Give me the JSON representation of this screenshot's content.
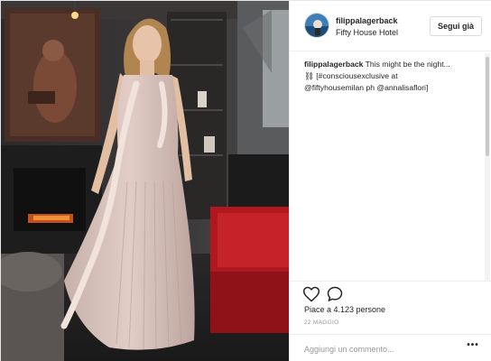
{
  "post": {
    "username": "filippalagerback",
    "location": "Fifty House Hotel",
    "follow_label": "Segui già",
    "caption_user": "filippalagerback",
    "caption_line1": "This might be the night...",
    "caption_line2": "⛓ [#consciousexclusive at",
    "caption_line3": "@fiftyhousemilan ph @annalisaflori]",
    "likes_text": "Piace a 4.123 persone",
    "date_text": "22 MAGGIO",
    "comment_placeholder": "Aggiungi un commento...",
    "more_label": "•••"
  },
  "icons": {
    "like": "heart-icon",
    "comment": "comment-bubble-icon",
    "more": "more-options-icon"
  },
  "colors": {
    "text": "#262626",
    "muted": "#999999",
    "border": "#dbdbdb"
  }
}
